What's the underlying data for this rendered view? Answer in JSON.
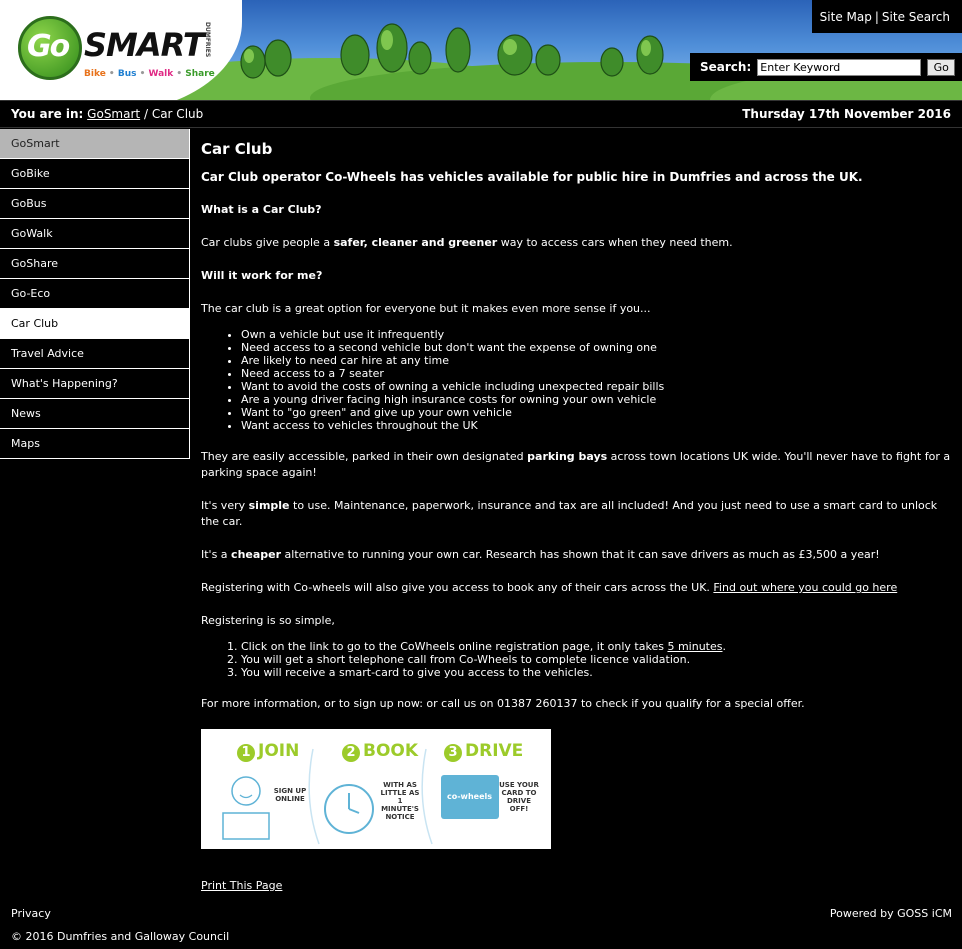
{
  "header": {
    "logo": {
      "go": "Go",
      "smart": "SMART",
      "dumfries": "DUMFRIES",
      "tagline": [
        "Bike",
        "Bus",
        "Walk",
        "Share"
      ]
    },
    "site_map": "Site Map",
    "site_search": "Site Search",
    "search_label": "Search:",
    "search_value": "Enter Keyword",
    "search_button": "Go"
  },
  "breadcrumb": {
    "you_are_in": "You are in:",
    "home": "GoSmart",
    "separator": "/",
    "current": "Car Club"
  },
  "date": "Thursday 17th November 2016",
  "sidebar": {
    "items": [
      {
        "label": "GoSmart"
      },
      {
        "label": "GoBike"
      },
      {
        "label": "GoBus"
      },
      {
        "label": "GoWalk"
      },
      {
        "label": "GoShare"
      },
      {
        "label": "Go-Eco"
      },
      {
        "label": "Car Club"
      },
      {
        "label": "Travel Advice"
      },
      {
        "label": "What's Happening?"
      },
      {
        "label": "News"
      },
      {
        "label": "Maps"
      }
    ]
  },
  "main": {
    "title": "Car Club",
    "lead": "Car Club operator Co-Wheels has vehicles available for public hire in Dumfries and across the UK.",
    "q1": "What is a Car Club?",
    "p1_a": "Car clubs give people a ",
    "p1_b": "safer, cleaner and greener",
    "p1_c": " way to access cars when they need them.",
    "q2": "Will it work for me?",
    "p2": "The car club is a great option for everyone but it makes even more sense if you...",
    "bullets": [
      "Own a vehicle but use it infrequently",
      "Need access to a second vehicle but don't want the expense of owning one",
      "Are likely to need car hire at any time",
      "Need access to a 7 seater",
      "Want to avoid the costs of owning a vehicle including unexpected repair bills",
      "Are a young driver facing high insurance costs for owning your own vehicle",
      "Want to \"go green\" and give up your own vehicle",
      "Want access to vehicles throughout the UK"
    ],
    "p3_a": "They are easily accessible, parked in their own designated ",
    "p3_b": "parking bays",
    "p3_c": " across town locations UK wide. You'll never have to fight for a parking space again!",
    "p4_a": "It's very ",
    "p4_b": "simple",
    "p4_c": " to use. Maintenance, paperwork, insurance and tax are all included! And you just need to use a smart card to unlock the car.",
    "p5_a": "It's a ",
    "p5_b": "cheaper",
    "p5_c": " alternative to running your own car. Research has shown that it can save drivers as much as £3,500 a year!",
    "p6_a": "Registering with Co-wheels will also give you access to book any of their cars across the UK. ",
    "p6_link": "Find out where you could go here",
    "p7": "Registering is so simple,",
    "steps": {
      "s1_a": "Click on the link to go to the CoWheels online registration page, it only takes ",
      "s1_link": "5 minutes",
      "s1_c": ".",
      "s2": "You will get a short telephone call from Co-Wheels to complete licence validation.",
      "s3": "You will receive a smart-card to give you access to the vehicles."
    },
    "p8": "For more information, or to sign up now: or call us on 01387 260137 to check if you qualify for a special offer.",
    "banner": {
      "join": "JOIN",
      "book": "BOOK",
      "drive": "DRIVE",
      "n1": "1",
      "n2": "2",
      "n3": "3",
      "note1": "SIGN UP ONLINE",
      "note2": "WITH AS LITTLE AS 1 MINUTE'S NOTICE",
      "note3": "USE YOUR CARD TO DRIVE OFF!",
      "cowheels": "co-wheels"
    },
    "print": "Print This Page"
  },
  "footer": {
    "privacy": "Privacy",
    "copyright": "© 2016 Dumfries and Galloway Council",
    "powered": "Powered by GOSS iCM"
  },
  "colors": {
    "background": "#000000",
    "sky": "#4f8ed8",
    "hill_green": "#5fae3a",
    "logo_green": "#3a9b2a"
  }
}
